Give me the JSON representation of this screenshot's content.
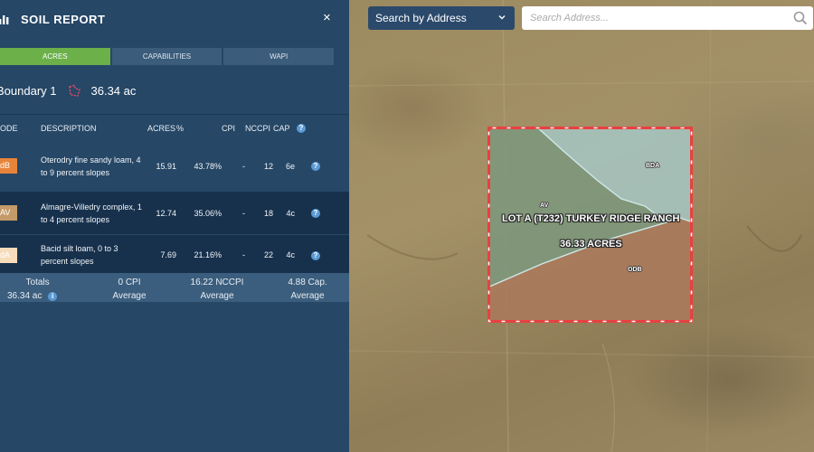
{
  "map": {
    "search_type_label": "Search by Address",
    "search_placeholder": "Search Address...",
    "parcel": {
      "name": "LOT A (T232) TURKEY RIDGE RANCH",
      "acres_label": "36.33 ACRES",
      "soil_labels": [
        "AV",
        "BDA",
        "ODB"
      ]
    }
  },
  "panel": {
    "title": "SOIL REPORT",
    "close_symbol": "×",
    "tabs": [
      {
        "label": "ACRES",
        "active": true
      },
      {
        "label": "CAPABILITIES",
        "active": false
      },
      {
        "label": "WAPI",
        "active": false
      }
    ],
    "boundary": {
      "name": "Boundary 1",
      "acres": "36.34 ac"
    },
    "table": {
      "headers": {
        "code": "ODE",
        "description": "DESCRIPTION",
        "acres": "ACRES",
        "percent": "%",
        "cpi": "CPI",
        "nccpi": "NCCPI",
        "cap": "CAP"
      },
      "rows": [
        {
          "code": "dB",
          "color": "#e8843a",
          "description": "Oterodry fine sandy loam, 4 to 9 percent slopes",
          "acres": "15.91",
          "percent": "43.78%",
          "cpi": "-",
          "nccpi": "12",
          "cap": "6e"
        },
        {
          "code": "AV",
          "color": "#c49a68",
          "description": "Almagre-Villedry complex, 1 to 4 percent slopes",
          "acres": "12.74",
          "percent": "35.06%",
          "cpi": "-",
          "nccpi": "18",
          "cap": "4c"
        },
        {
          "code": "dA",
          "color": "#f7dcbc",
          "description": "Bacid silt loam, 0 to 3 percent slopes",
          "acres": "7.69",
          "percent": "21.16%",
          "cpi": "-",
          "nccpi": "22",
          "cap": "4c"
        }
      ]
    },
    "totals": {
      "label": "Totals",
      "acres": "36.34 ac",
      "cpi_value": "0 CPI",
      "cpi_sub": "Average",
      "nccpi_value": "16.22 NCCPI",
      "nccpi_sub": "Average",
      "cap_value": "4.88 Cap.",
      "cap_sub": "Average"
    }
  },
  "colors": {
    "panel_bg": "#264766",
    "tab_active": "#6cb04a",
    "boundary_red": "#e84040"
  }
}
